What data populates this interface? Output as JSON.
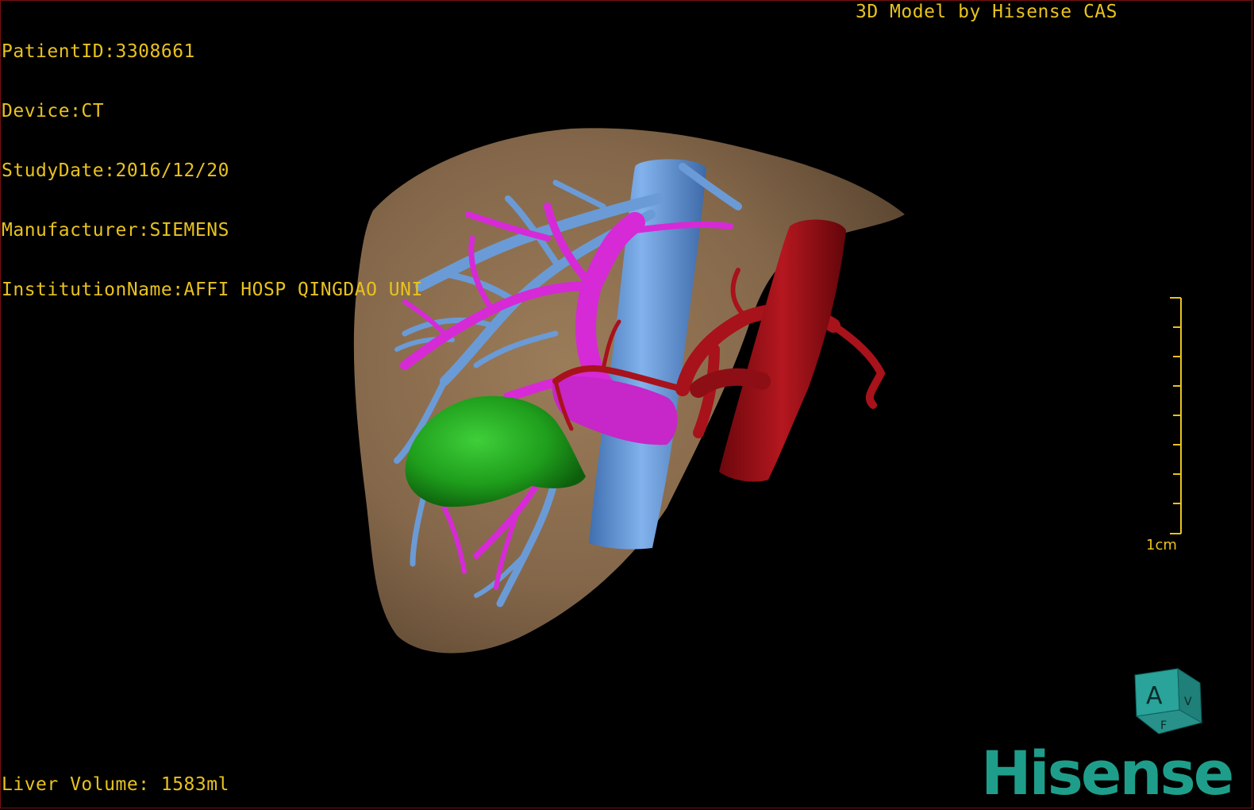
{
  "dicom": {
    "patient_id": "PatientID:3308661",
    "device": "Device:CT",
    "study_date": "StudyDate:2016/12/20",
    "manufacturer": "Manufacturer:SIEMENS",
    "institution": "InstitutionName:AFFI HOSP QINGDAO UNI"
  },
  "vendor_label": "3D Model by Hisense CAS",
  "liver_volume": "Liver Volume: 1583ml",
  "scale": {
    "label": "1cm"
  },
  "orientation_cube": {
    "front_face": "A",
    "side_face": "V",
    "bottom_face": "F"
  },
  "brand": "Hisense",
  "colors": {
    "background": "#000000",
    "overlay_text": "#e8c21f",
    "liver": "#8a6c4c",
    "portal_vein": "#d62ad6",
    "hepatic_vein": "#6b9bd6",
    "ivc": "#6a9ee0",
    "artery": "#a8121a",
    "tumor": "#20a020",
    "brand": "#1e9e8a"
  }
}
